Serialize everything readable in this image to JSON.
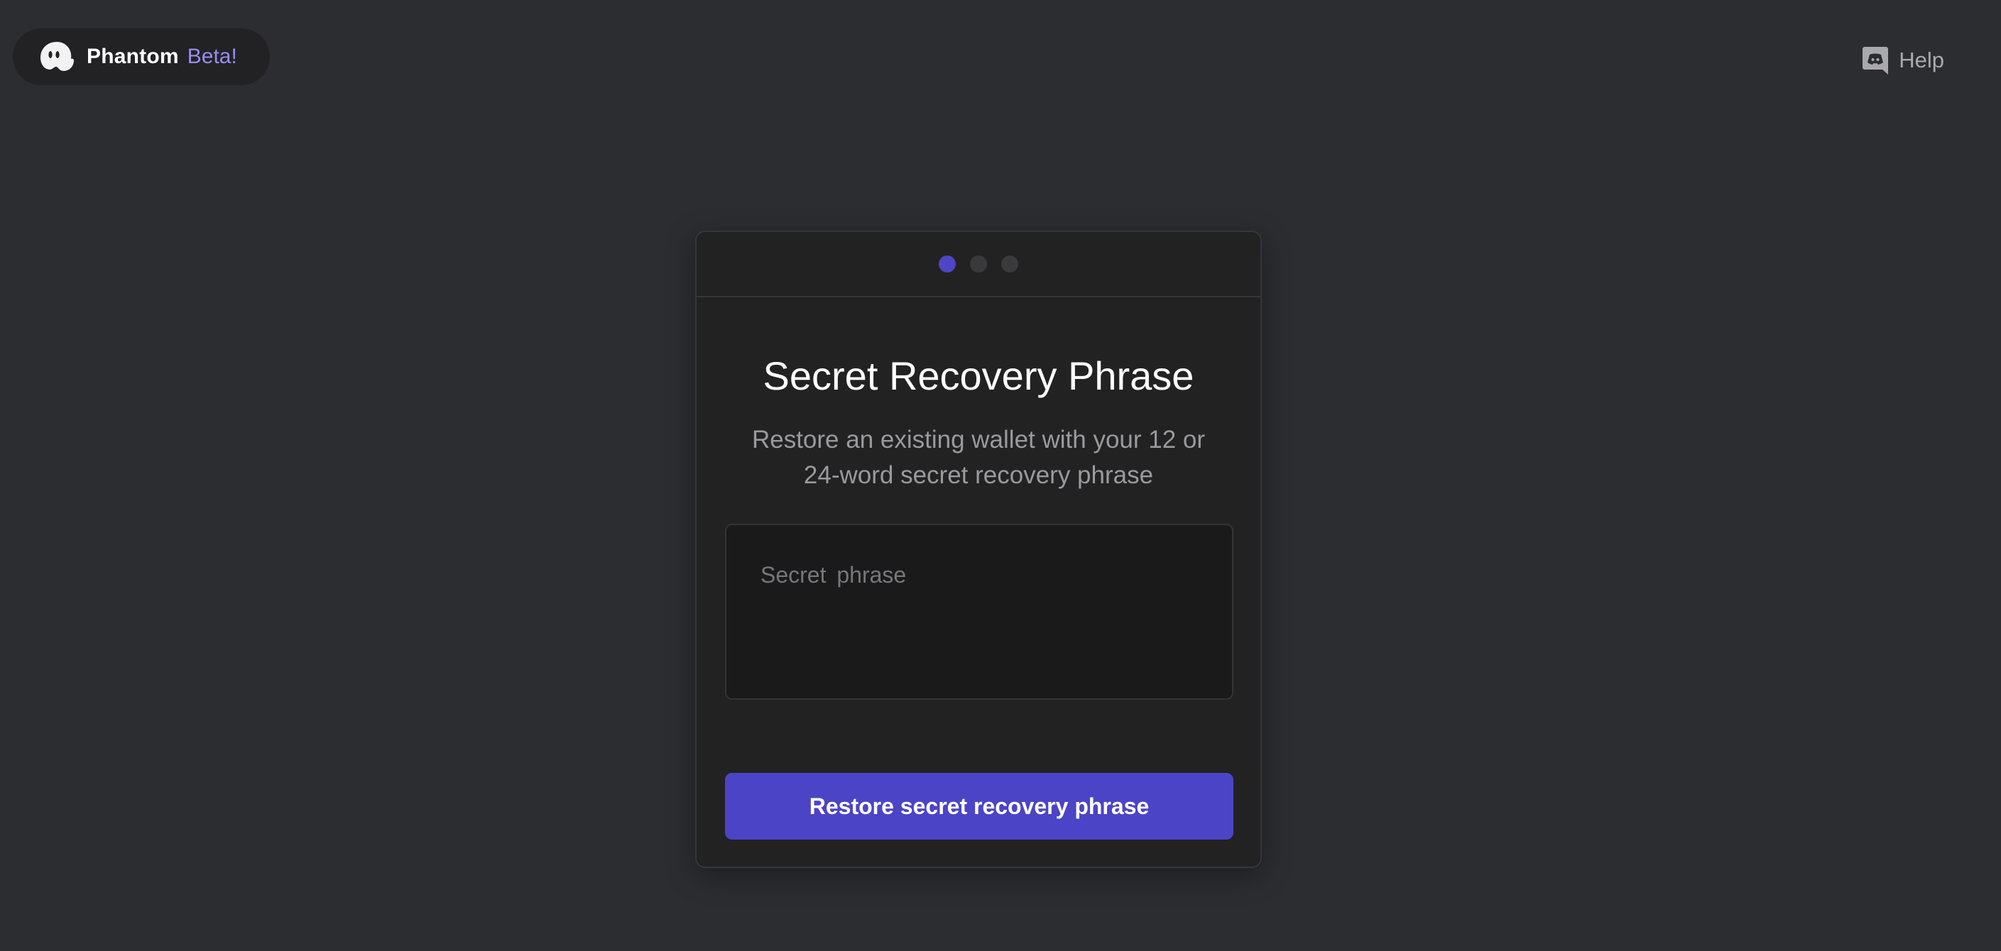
{
  "header": {
    "brand_name": "Phantom",
    "brand_tag": "Beta!",
    "logo_icon": "ghost-logo-icon",
    "help_label": "Help",
    "help_icon": "discord-icon"
  },
  "card": {
    "steps_total": 3,
    "current_step": 1,
    "title": "Secret Recovery Phrase",
    "subtitle": "Restore an existing wallet with your 12 or 24-word secret recovery phrase",
    "input": {
      "placeholder": "Secret phrase",
      "value": ""
    },
    "button_label": "Restore secret recovery phrase"
  },
  "colors": {
    "background": "#2c2d31",
    "card": "#222222",
    "accent": "#4c44c6",
    "beta_text": "#9a8cf0",
    "step_active": "#4f45c8",
    "step_inactive": "#3a3a3c"
  }
}
